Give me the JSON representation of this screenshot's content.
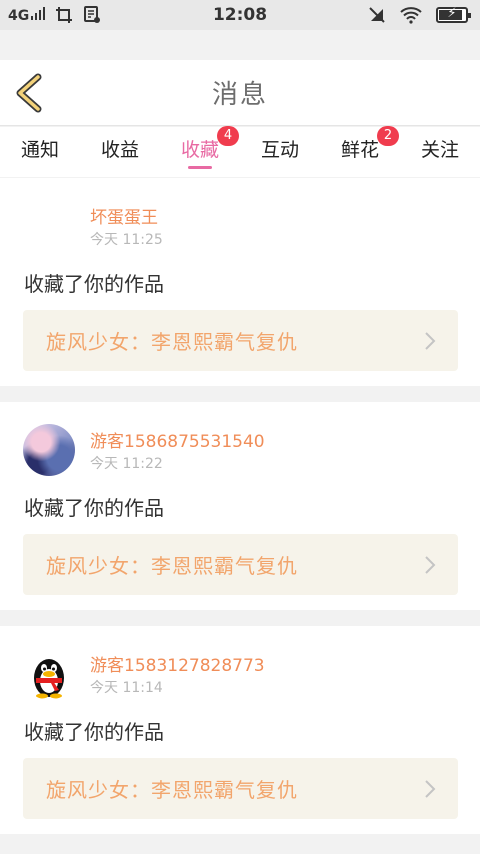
{
  "status_bar": {
    "network": "4G",
    "time": "12:08",
    "battery_level": 0.9
  },
  "header": {
    "title": "消息",
    "back_icon": "chevron-left-icon",
    "accent_color": "#f3d27a"
  },
  "tabs": [
    {
      "label": "通知",
      "badge": "",
      "active": false
    },
    {
      "label": "收益",
      "badge": "",
      "active": false
    },
    {
      "label": "收藏",
      "badge": "4",
      "active": true
    },
    {
      "label": "互动",
      "badge": "",
      "active": false
    },
    {
      "label": "鲜花",
      "badge": "2",
      "active": false
    },
    {
      "label": "关注",
      "badge": "",
      "active": false
    }
  ],
  "colors": {
    "active_tab": "#e86aa3",
    "badge": "#f03c4e",
    "username": "#f08d58",
    "work_title": "#f2a56c",
    "work_box_bg": "#f6f3ea"
  },
  "messages": [
    {
      "user": "坏蛋蛋王",
      "time": "今天 11:25",
      "action": "收藏了你的作品",
      "work": "旋风少女：李恩熙霸气复仇",
      "avatar": "none"
    },
    {
      "user": "游客1586875531540",
      "time": "今天 11:22",
      "action": "收藏了你的作品",
      "work": "旋风少女：李恩熙霸气复仇",
      "avatar": "anime-avatar"
    },
    {
      "user": "游客1583127828773",
      "time": "今天 11:14",
      "action": "收藏了你的作品",
      "work": "旋风少女：李恩熙霸气复仇",
      "avatar": "qq-penguin-avatar"
    }
  ]
}
